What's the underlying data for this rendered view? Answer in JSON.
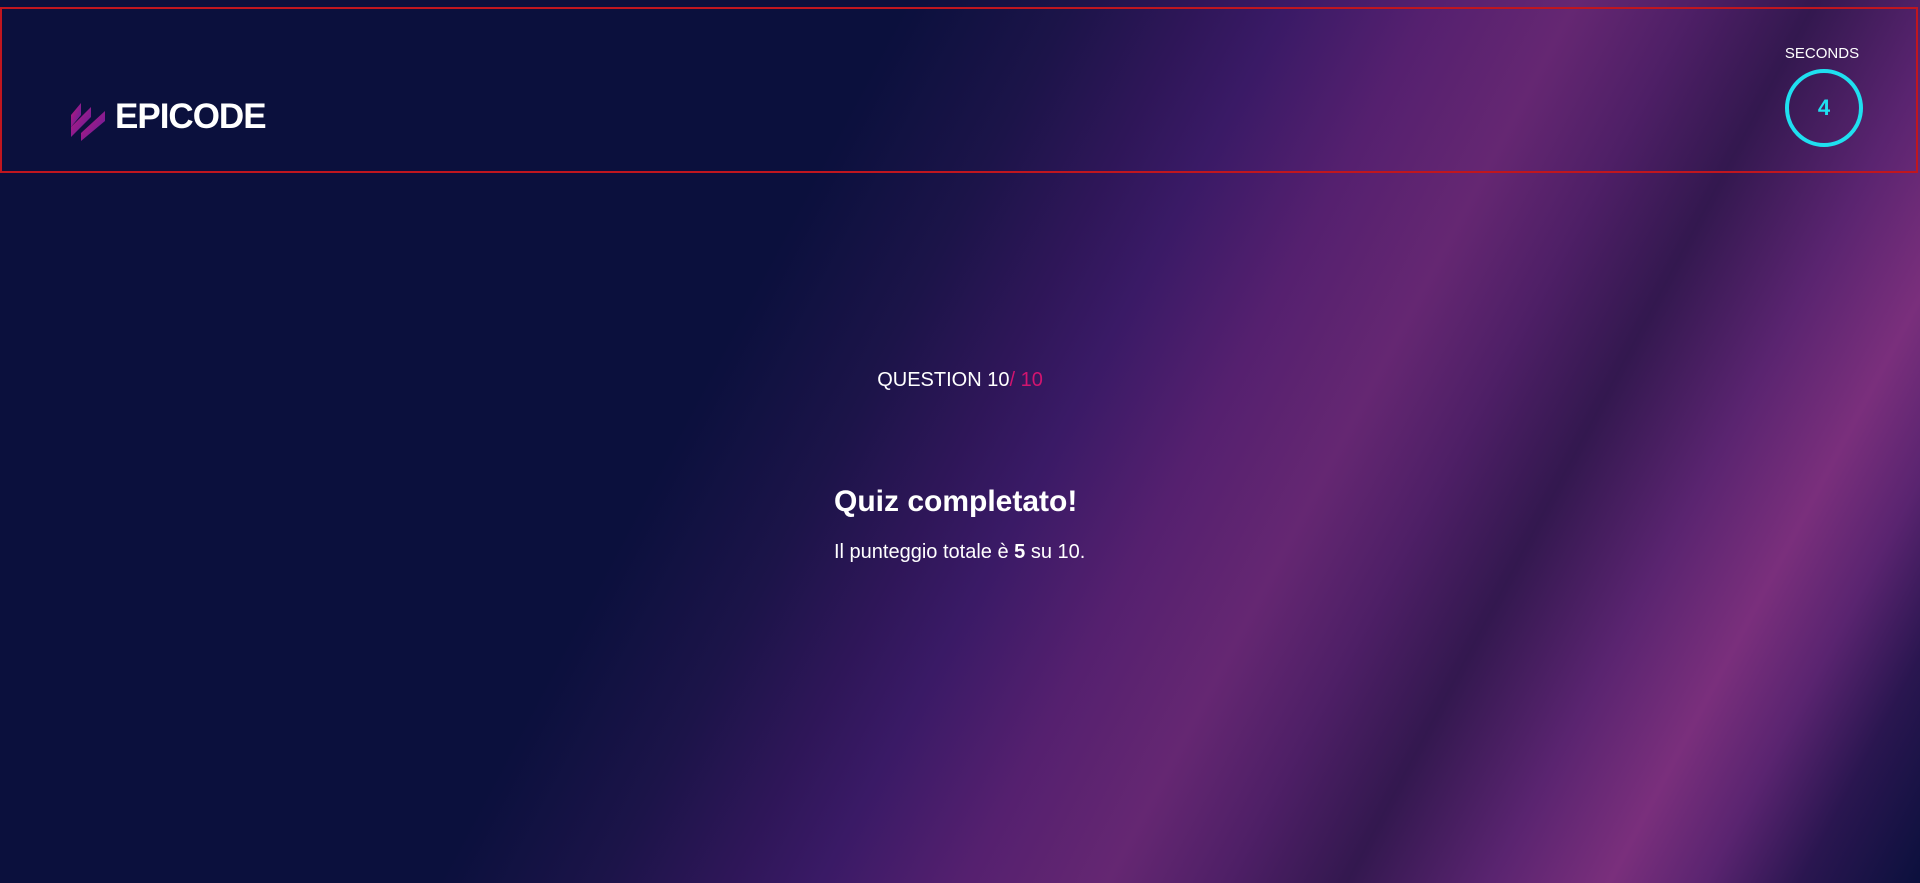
{
  "header": {
    "logo_text": "EPICODE",
    "timer": {
      "label": "SECONDS",
      "value": "4"
    }
  },
  "quiz": {
    "counter_prefix": "QUESTION 10",
    "counter_total": "/ 10",
    "title": "Quiz completato!",
    "score_prefix": "Il punteggio totale è ",
    "score_value": "5",
    "score_suffix": " su 10."
  },
  "colors": {
    "background": "#0b103d",
    "accent_pink": "#d2146f",
    "timer_cyan": "#1fe0f0",
    "header_border": "#c0161f"
  }
}
